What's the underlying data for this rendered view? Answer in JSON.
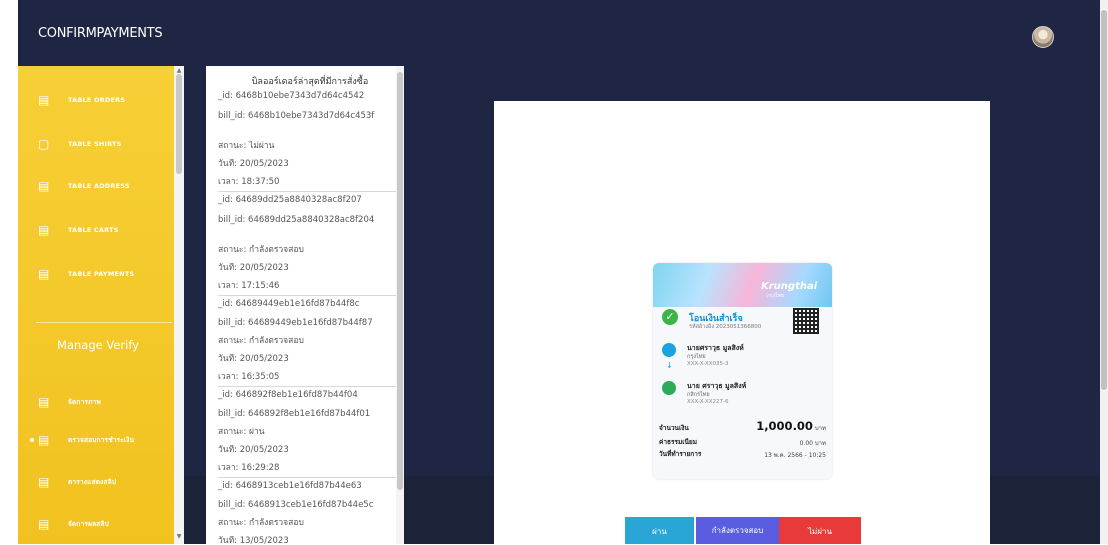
{
  "app": {
    "brand": "CONFIRMPAYMENTS"
  },
  "sidebar": {
    "items": [
      {
        "label": "TABLE ORDERS",
        "icon": "list-icon"
      },
      {
        "label": "TABLE SHIRTS",
        "icon": "shirt-icon"
      },
      {
        "label": "TABLE ADDRESS",
        "icon": "list-icon"
      },
      {
        "label": "TABLE CARTS",
        "icon": "list-icon"
      },
      {
        "label": "TABLE PAYMENTS",
        "icon": "list-icon"
      }
    ],
    "section_title": "Manage Verify",
    "verify_items": [
      {
        "label": "จัดการภาพ",
        "icon": "list-icon"
      },
      {
        "label": "ตรวจสอบการชำระเงิน",
        "icon": "list-icon",
        "active": true
      },
      {
        "label": "ตารางแสดงสลิป",
        "icon": "list-icon"
      },
      {
        "label": "จัดการผลสลิป",
        "icon": "list-icon"
      }
    ]
  },
  "orders": {
    "title": "บิลออร์เดอร์ล่าสุดที่มีการสั่งซื้อ",
    "records": [
      {
        "id": "_id: 6468b10ebe7343d7d64c4542",
        "bill_id": "bill_id: 6468b10ebe7343d7d64c453f",
        "status": "สถานะ: ไม่ผ่าน",
        "date": "วันที่: 20/05/2023",
        "time": "เวลา: 18:37:50"
      },
      {
        "id": "_id: 64689dd25a8840328ac8f207",
        "bill_id": "bill_id: 64689dd25a8840328ac8f204",
        "status": "สถานะ: กำลังตรวจสอบ",
        "date": "วันที่: 20/05/2023",
        "time": "เวลา: 17:15:46"
      },
      {
        "id": "_id: 64689449eb1e16fd87b44f8c",
        "bill_id": "bill_id: 64689449eb1e16fd87b44f87",
        "status": "สถานะ: กำลังตรวจสอบ",
        "date": "วันที่: 20/05/2023",
        "time": "เวลา: 16:35:05"
      },
      {
        "id": "_id: 646892f8eb1e16fd87b44f04",
        "bill_id": "bill_id: 646892f8eb1e16fd87b44f01",
        "status": "สถานะ: ผ่าน",
        "date": "วันที่: 20/05/2023",
        "time": "เวลา: 16:29:28"
      },
      {
        "id": "_id: 6468913ceb1e16fd87b44e63",
        "bill_id": "bill_id: 6468913ceb1e16fd87b44e5c",
        "status": "สถานะ: กำลังตรวจสอบ",
        "date": "วันที่: 13/05/2023",
        "time": ""
      }
    ]
  },
  "receipt": {
    "bank_brand": "Krungthai",
    "bank_sub": "กรุงไทย",
    "success_text": "โอนเงินสำเร็จ",
    "ref": "รหัสอ้างอิง 2023051366800",
    "sender_name": "นายศราวุธ มูลสิงห์",
    "sender_bank": "กรุงไทย",
    "sender_acct": "XXX-X-XX035-3",
    "receiver_name": "นาย ศราวุธ มูลสิงห์",
    "receiver_bank": "กสิกรไทย",
    "receiver_acct": "XXX-X-XX227-6",
    "amount_label": "จำนวนเงิน",
    "amount": "1,000.00",
    "amount_unit": "บาท",
    "fee_label": "ค่าธรรมเนียม",
    "fee": "0.00 บาท",
    "date_label": "วันที่ทำรายการ",
    "date": "13 พ.ค. 2566 - 10:25"
  },
  "actions": {
    "pass": "ผ่าน",
    "checking": "กำลังตรวจสอบ",
    "fail": "ไม่ผ่าน"
  },
  "colors": {
    "dark_bg": "#1e2643",
    "sidebar": "#f4c72a",
    "pass": "#29a5d6",
    "checking": "#5a5de0",
    "fail": "#e83a3a"
  }
}
